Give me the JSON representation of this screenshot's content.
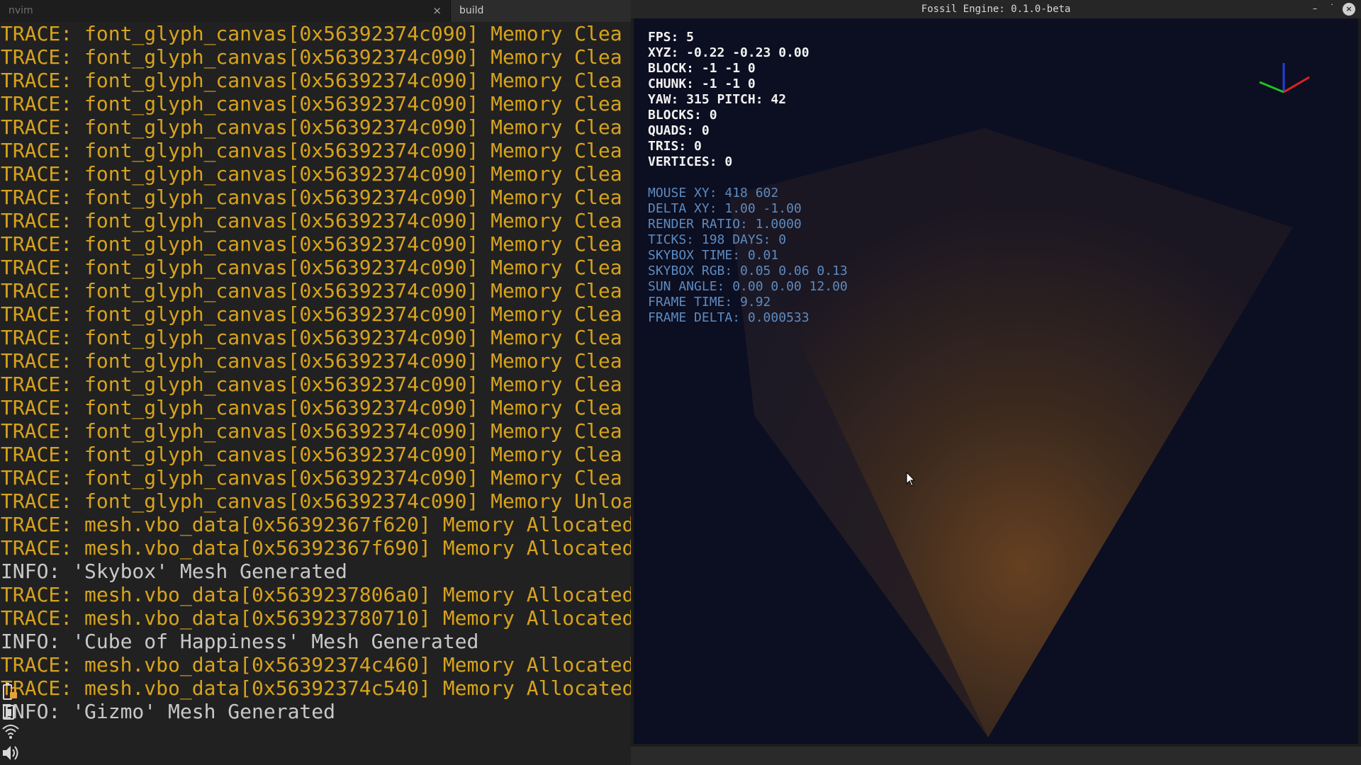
{
  "terminal": {
    "tabs": [
      {
        "label": "nvim",
        "close": "×"
      },
      {
        "label": "build"
      }
    ],
    "lines": [
      {
        "level": "trace",
        "text": "TRACE: font_glyph_canvas[0x56392374c090] Memory Clea"
      },
      {
        "level": "trace",
        "text": "TRACE: font_glyph_canvas[0x56392374c090] Memory Clea"
      },
      {
        "level": "trace",
        "text": "TRACE: font_glyph_canvas[0x56392374c090] Memory Clea"
      },
      {
        "level": "trace",
        "text": "TRACE: font_glyph_canvas[0x56392374c090] Memory Clea"
      },
      {
        "level": "trace",
        "text": "TRACE: font_glyph_canvas[0x56392374c090] Memory Clea"
      },
      {
        "level": "trace",
        "text": "TRACE: font_glyph_canvas[0x56392374c090] Memory Clea"
      },
      {
        "level": "trace",
        "text": "TRACE: font_glyph_canvas[0x56392374c090] Memory Clea"
      },
      {
        "level": "trace",
        "text": "TRACE: font_glyph_canvas[0x56392374c090] Memory Clea"
      },
      {
        "level": "trace",
        "text": "TRACE: font_glyph_canvas[0x56392374c090] Memory Clea"
      },
      {
        "level": "trace",
        "text": "TRACE: font_glyph_canvas[0x56392374c090] Memory Clea"
      },
      {
        "level": "trace",
        "text": "TRACE: font_glyph_canvas[0x56392374c090] Memory Clea"
      },
      {
        "level": "trace",
        "text": "TRACE: font_glyph_canvas[0x56392374c090] Memory Clea"
      },
      {
        "level": "trace",
        "text": "TRACE: font_glyph_canvas[0x56392374c090] Memory Clea"
      },
      {
        "level": "trace",
        "text": "TRACE: font_glyph_canvas[0x56392374c090] Memory Clea"
      },
      {
        "level": "trace",
        "text": "TRACE: font_glyph_canvas[0x56392374c090] Memory Clea"
      },
      {
        "level": "trace",
        "text": "TRACE: font_glyph_canvas[0x56392374c090] Memory Clea"
      },
      {
        "level": "trace",
        "text": "TRACE: font_glyph_canvas[0x56392374c090] Memory Clea"
      },
      {
        "level": "trace",
        "text": "TRACE: font_glyph_canvas[0x56392374c090] Memory Clea"
      },
      {
        "level": "trace",
        "text": "TRACE: font_glyph_canvas[0x56392374c090] Memory Clea"
      },
      {
        "level": "trace",
        "text": "TRACE: font_glyph_canvas[0x56392374c090] Memory Clea"
      },
      {
        "level": "trace",
        "text": "TRACE: font_glyph_canvas[0x56392374c090] Memory Unloa"
      },
      {
        "level": "trace",
        "text": "TRACE: mesh.vbo_data[0x56392367f620] Memory Allocated"
      },
      {
        "level": "trace",
        "text": "TRACE: mesh.vbo_data[0x56392367f690] Memory Allocated"
      },
      {
        "level": "info",
        "text": "INFO: 'Skybox' Mesh Generated"
      },
      {
        "level": "trace",
        "text": "TRACE: mesh.vbo_data[0x5639237806a0] Memory Allocated"
      },
      {
        "level": "trace",
        "text": "TRACE: mesh.vbo_data[0x563923780710] Memory Allocated"
      },
      {
        "level": "info",
        "text": "INFO: 'Cube of Happiness' Mesh Generated"
      },
      {
        "level": "trace",
        "text": "TRACE: mesh.vbo_data[0x56392374c460] Memory Allocated"
      },
      {
        "level": "trace",
        "text": "TRACE: mesh.vbo_data[0x56392374c540] Memory Allocated"
      },
      {
        "level": "info",
        "text": "INFO: 'Gizmo' Mesh Generated"
      }
    ],
    "tray_icons": [
      "battery-locked-icon",
      "clipboard-icon",
      "wifi-icon",
      "volume-icon"
    ]
  },
  "engine_window": {
    "title": "Fossil Engine: 0.1.0-beta",
    "controls": {
      "minimize": "–",
      "maximize": "˙",
      "close": "×"
    },
    "skybox_color": "#0c0e21",
    "hud_primary": [
      "FPS: 5",
      "XYZ: -0.22 -0.23 0.00",
      "BLOCK: -1 -1 0",
      "CHUNK: -1 -1 0",
      "YAW: 315 PITCH: 42",
      "BLOCKS: 0",
      "QUADS: 0",
      "TRIS: 0",
      "VERTICES: 0"
    ],
    "hud_secondary": [
      "MOUSE XY: 418 602",
      "DELTA XY: 1.00 -1.00",
      "RENDER RATIO: 1.0000",
      "TICKS: 198 DAYS: 0",
      "SKYBOX TIME: 0.01",
      "SKYBOX RGB: 0.05 0.06 0.13",
      "SUN ANGLE: 0.00 0.00 12.00",
      "FRAME TIME: 9.92",
      "FRAME DELTA: 0.000533"
    ],
    "gizmo_axes": {
      "x": "#e02020",
      "y": "#20c020",
      "z": "#2040e0"
    }
  }
}
